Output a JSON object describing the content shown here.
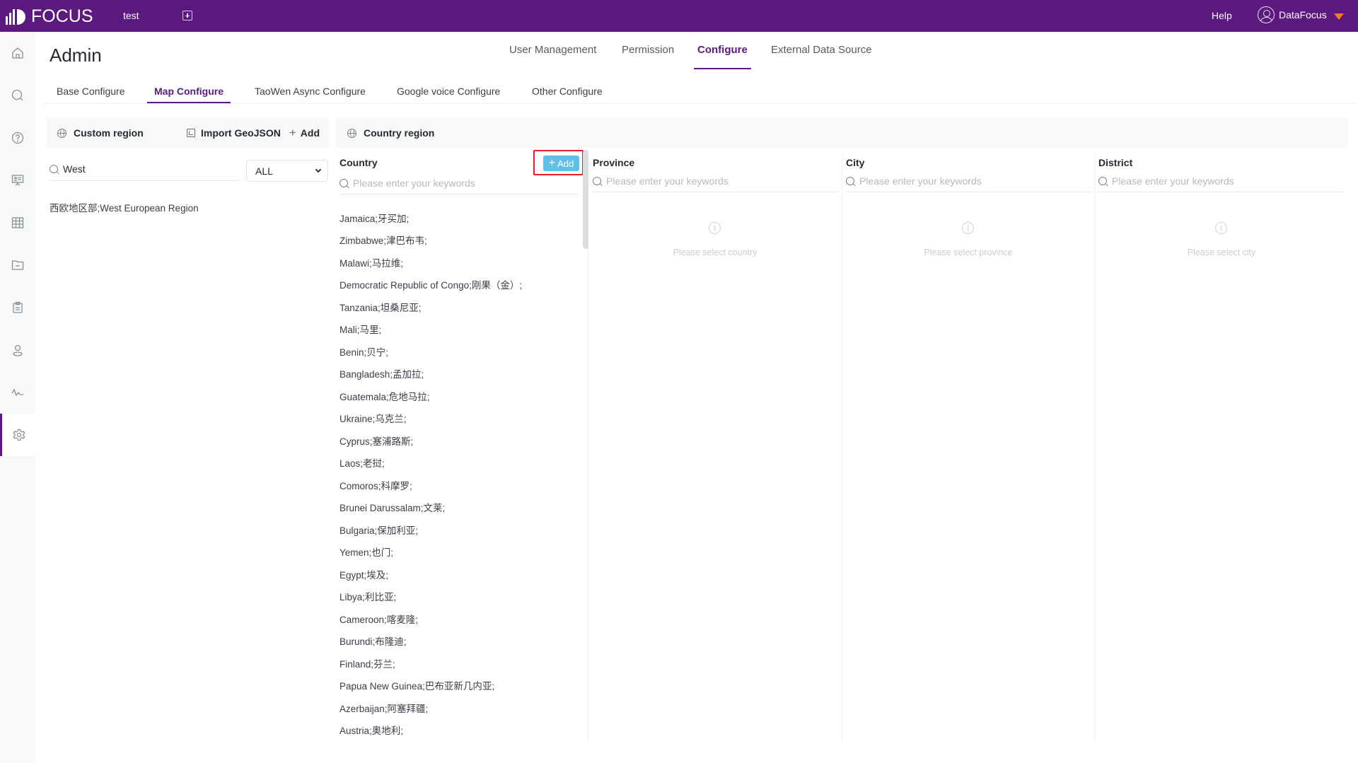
{
  "header": {
    "logo_text": "FOCUS",
    "project_name": "test",
    "help_label": "Help",
    "user_name": "DataFocus",
    "brand_color": "#5c1a7e",
    "accent_color": "#f27a2d"
  },
  "sidebar": {
    "items": [
      {
        "name": "home",
        "icon": "home-icon",
        "active": false
      },
      {
        "name": "search",
        "icon": "search-icon",
        "active": false
      },
      {
        "name": "help",
        "icon": "question-icon",
        "active": false
      },
      {
        "name": "dashboard",
        "icon": "presentation-icon",
        "active": false
      },
      {
        "name": "data-table",
        "icon": "grid-icon",
        "active": false
      },
      {
        "name": "folder",
        "icon": "folder-icon",
        "active": false
      },
      {
        "name": "tasks",
        "icon": "clipboard-icon",
        "active": false
      },
      {
        "name": "user",
        "icon": "user-icon",
        "active": false
      },
      {
        "name": "monitor",
        "icon": "pulse-icon",
        "active": false
      },
      {
        "name": "settings",
        "icon": "gear-icon",
        "active": true
      }
    ]
  },
  "page": {
    "title": "Admin"
  },
  "top_tabs": [
    {
      "label": "User Management",
      "active": false
    },
    {
      "label": "Permission",
      "active": false
    },
    {
      "label": "Configure",
      "active": true
    },
    {
      "label": "External Data Source",
      "active": false
    }
  ],
  "sub_tabs": [
    {
      "label": "Base Configure",
      "active": false
    },
    {
      "label": "Map Configure",
      "active": true
    },
    {
      "label": "TaoWen Async Configure",
      "active": false
    },
    {
      "label": "Google voice Configure",
      "active": false
    },
    {
      "label": "Other Configure",
      "active": false
    }
  ],
  "custom_region": {
    "title": "Custom region",
    "import_label": "Import GeoJSON",
    "add_label": "Add",
    "search_value": "West",
    "filter_value": "ALL",
    "items": [
      "西欧地区部;West European Region"
    ]
  },
  "country_region": {
    "title": "Country region",
    "columns": {
      "country": {
        "title": "Country",
        "add_label": "Add",
        "search_placeholder": "Please enter your keywords",
        "items": [
          "Jamaica;牙买加;",
          "Zimbabwe;津巴布韦;",
          "Malawi;马拉维;",
          "Democratic Republic of Congo;刚果（金）;",
          "Tanzania;坦桑尼亚;",
          "Mali;马里;",
          "Benin;贝宁;",
          "Bangladesh;孟加拉;",
          "Guatemala;危地马拉;",
          "Ukraine;乌克兰;",
          "Cyprus;塞浦路斯;",
          "Laos;老挝;",
          "Comoros;科摩罗;",
          "Brunei Darussalam;文莱;",
          "Bulgaria;保加利亚;",
          "Yemen;也门;",
          "Egypt;埃及;",
          "Libya;利比亚;",
          "Cameroon;喀麦隆;",
          "Burundi;布隆迪;",
          "Finland;芬兰;",
          "Papua New Guinea;巴布亚新几内亚;",
          "Azerbaijan;阿塞拜疆;",
          "Austria;奥地利;"
        ]
      },
      "province": {
        "title": "Province",
        "search_placeholder": "Please enter your keywords",
        "empty_text": "Please select country"
      },
      "city": {
        "title": "City",
        "search_placeholder": "Please enter your keywords",
        "empty_text": "Please select province"
      },
      "district": {
        "title": "District",
        "search_placeholder": "Please enter your keywords",
        "empty_text": "Please select city"
      }
    }
  }
}
